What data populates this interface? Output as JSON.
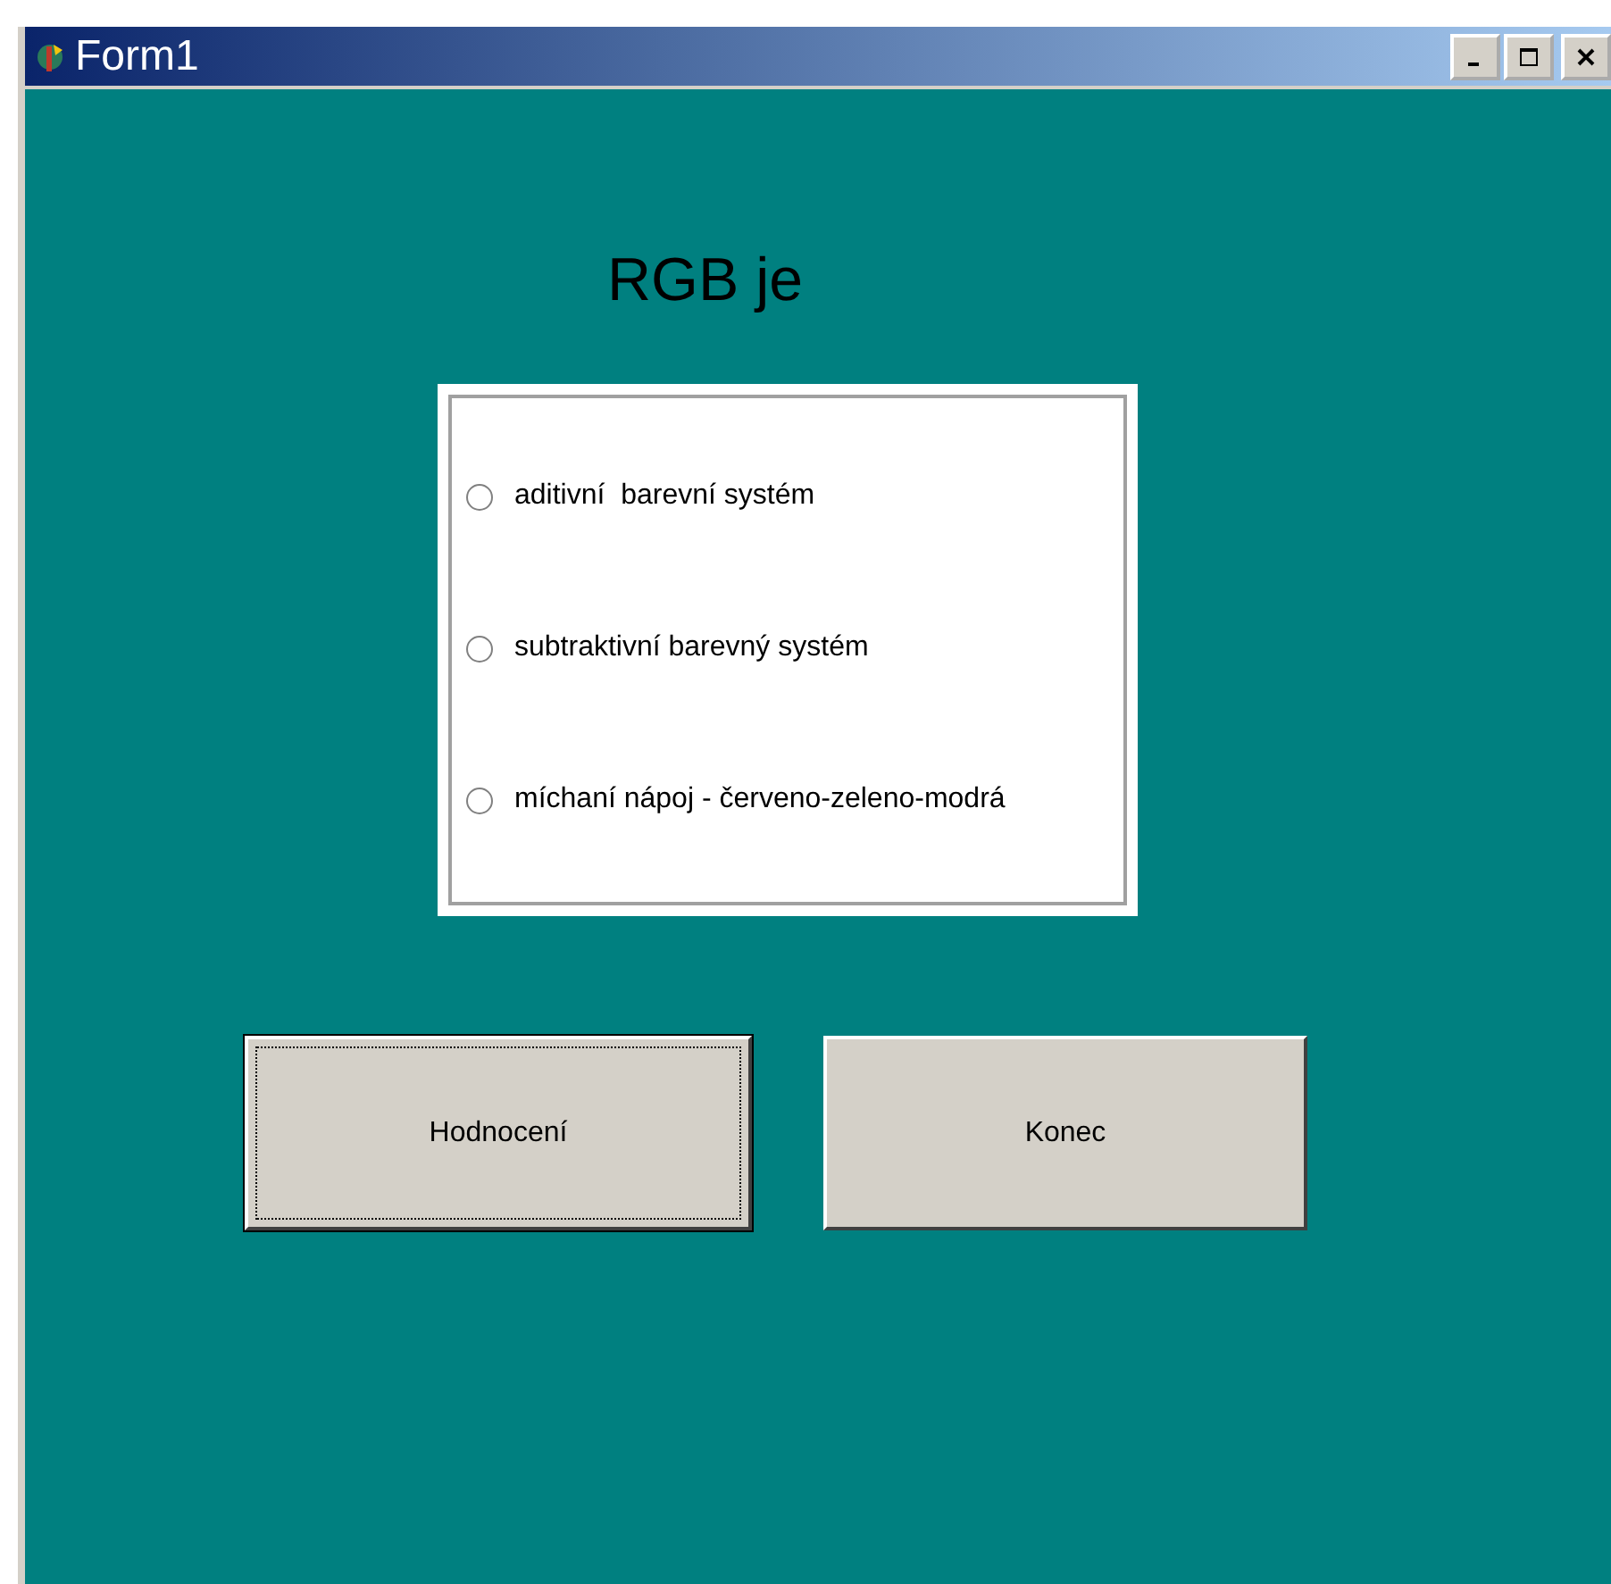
{
  "window": {
    "title": "Form1"
  },
  "heading": "RGB je",
  "options": [
    {
      "label": "aditivní  barevní systém",
      "selected": false
    },
    {
      "label": "subtraktivní barevný systém",
      "selected": false
    },
    {
      "label": "míchaní nápoj - červeno-zeleno-modrá",
      "selected": false
    }
  ],
  "buttons": [
    {
      "label": "Hodnocení",
      "focused": true
    },
    {
      "label": "Konec",
      "focused": false
    }
  ]
}
